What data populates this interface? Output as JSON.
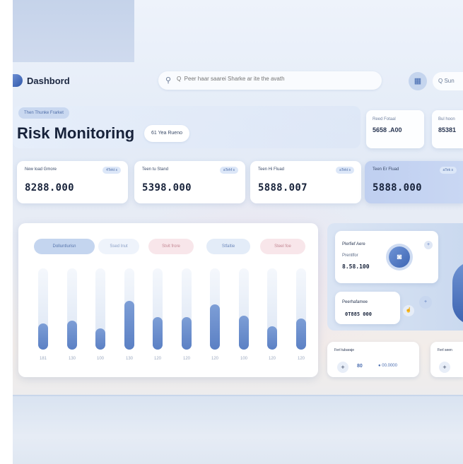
{
  "header": {
    "brand": "Dashbord",
    "search_placeholder": "Q  Peer haar saarei Sharke ar ite the avath",
    "calendar_icon": "calendar-icon",
    "search2_label": "Q  Sun"
  },
  "title_area": {
    "chip_top": "Then Thunke Frarket",
    "title": "Risk Monitoring",
    "title_chip": "61 Yea Rueno"
  },
  "mini_cards": [
    {
      "label": "Reed Fotaal",
      "value": "5658 .A00"
    },
    {
      "label": "Bul hoon",
      "value": "85381"
    }
  ],
  "stats": [
    {
      "label": "New load Gmore",
      "badge": "4Tekt s",
      "value": "8288.000"
    },
    {
      "label": "Teen tu Stand",
      "badge": "aTehf s",
      "value": "5398.000"
    },
    {
      "label": "Teen Hi Fluad",
      "badge": "aTekt s",
      "value": "5888.007"
    },
    {
      "label": "Teen Er Fluad",
      "badge": "aTek s",
      "value": "5888.000"
    }
  ],
  "chart_filters": [
    "Dolluntlurisn",
    "Ssed Inut",
    "Stvit frore",
    "Stfaltie",
    "Steel foe"
  ],
  "chart_data": {
    "type": "bar",
    "categories": [
      "181",
      "130",
      "100",
      "130",
      "120",
      "120",
      "120",
      "100",
      "120",
      "120"
    ],
    "values": [
      32,
      36,
      26,
      60,
      40,
      40,
      56,
      42,
      29,
      38
    ],
    "ylim": [
      0,
      100
    ],
    "colors": {
      "fill": "#5b80c4",
      "track": "#dbe5f4"
    }
  },
  "right_panel": {
    "card1": {
      "title": "Plerfief Aere",
      "subtitle": "Prentlfor",
      "value": "8.58.100"
    },
    "card2": {
      "title": "Peerhafamee",
      "value": "0T885 000"
    }
  },
  "bottom_cards": [
    {
      "title": "Ferl tubaraje",
      "value1": "80",
      "value2": "● 00.0000"
    },
    {
      "title": "Ferl seen"
    }
  ]
}
